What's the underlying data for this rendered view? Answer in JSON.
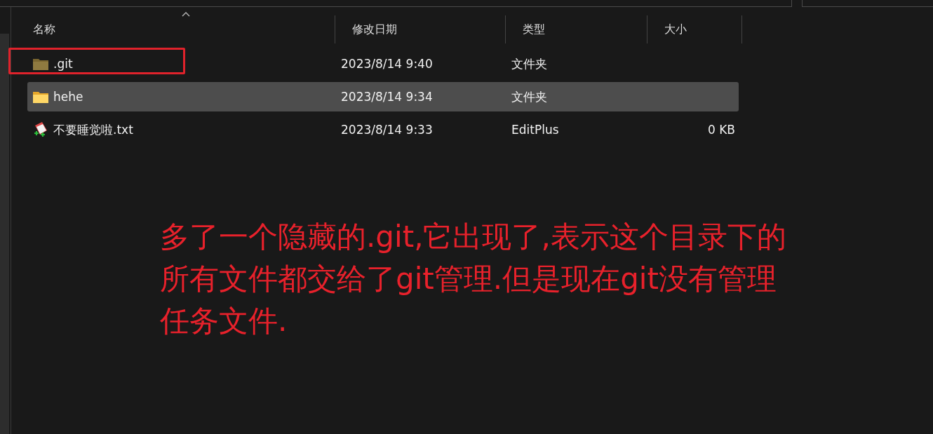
{
  "columns": [
    {
      "label": "名称",
      "sorted": true
    },
    {
      "label": "修改日期",
      "sorted": false
    },
    {
      "label": "类型",
      "sorted": false
    },
    {
      "label": "大小",
      "sorted": false
    }
  ],
  "rows": [
    {
      "kind": "folder",
      "name": ".git",
      "date": "2023/8/14 9:40",
      "type": "文件夹",
      "hidden": true,
      "selected": false,
      "highlighted": true
    },
    {
      "kind": "folder",
      "name": "hehe",
      "date": "2023/8/14 9:34",
      "type": "文件夹",
      "hidden": false,
      "selected": true,
      "highlighted": false
    },
    {
      "kind": "file",
      "name": "不要睡觉啦.txt",
      "date": "2023/8/14 9:33",
      "type": "EditPlus",
      "size": "0 KB",
      "hidden": false,
      "selected": false,
      "highlighted": false
    }
  ],
  "annotation": {
    "lines": [
      "多了一个隐藏的.git,它出现了,表示这个目录下的",
      "所有文件都交给了git管理.但是现在git没有管理",
      "任务文件."
    ]
  }
}
